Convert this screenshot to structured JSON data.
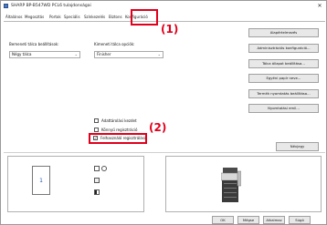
{
  "window": {
    "title": "SHARP BP-B547WD PCL6 tulajdonságai",
    "close_glyph": "✕"
  },
  "tabs": [
    {
      "label": "Általános"
    },
    {
      "label": "Megosztás"
    },
    {
      "label": "Portok"
    },
    {
      "label": "Speciális"
    },
    {
      "label": "Színkezelés"
    },
    {
      "label": "Biztons"
    },
    {
      "label": "Konfiguráció"
    }
  ],
  "callouts": {
    "one": "(1)",
    "two": "(2)"
  },
  "input_tray": {
    "label": "Bemeneti tálca beállítások:",
    "value": "Négy tálca"
  },
  "output_tray": {
    "label": "Kimeneti tálca opciók:",
    "value": "Finisher"
  },
  "right_buttons": [
    {
      "label": "Alapértelmezés"
    },
    {
      "label": "Adminisztrációs konfiguráció..."
    },
    {
      "label": "Tálca állapot beállítása..."
    },
    {
      "label": "Egyéni papír neve..."
    },
    {
      "label": "Termék nyomtatás beállítása..."
    },
    {
      "label": "Nyomtatási emil..."
    }
  ],
  "checkboxes": [
    {
      "label": "Adattárolási kezdet",
      "checked": false
    },
    {
      "label": "Könnyű regisztráció",
      "checked": false
    },
    {
      "label": "Felhasználó regisztrálása",
      "checked": true
    }
  ],
  "about_button": {
    "label": "Névjegy"
  },
  "preview": {
    "page_number": "1"
  },
  "footer_buttons": [
    {
      "label": "OK"
    },
    {
      "label": "Mégse"
    },
    {
      "label": "Alkalmaz"
    },
    {
      "label": "Súgó"
    }
  ],
  "colors": {
    "highlight": "#e0001b",
    "page_number": "#2155b5"
  }
}
